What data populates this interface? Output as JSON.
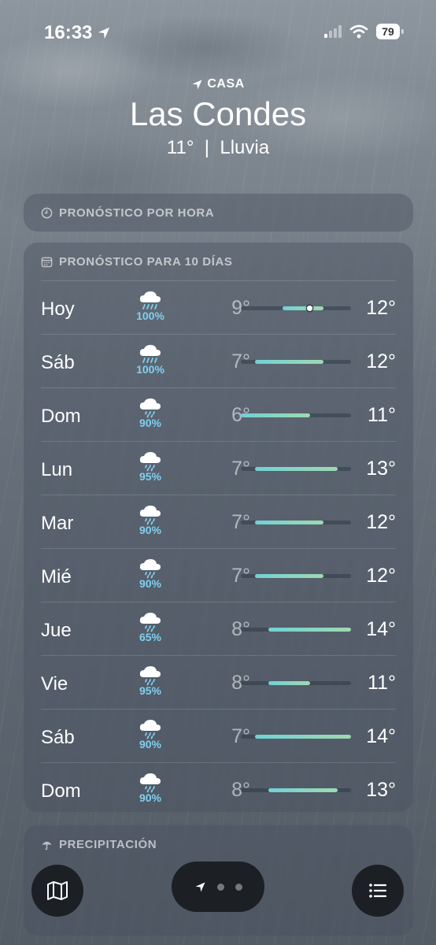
{
  "status": {
    "time": "16:33",
    "battery": "79"
  },
  "header": {
    "location_label": "CASA",
    "city": "Las Condes",
    "temp": "11°",
    "separator": "|",
    "condition": "Lluvia"
  },
  "hourly": {
    "title": "PRONÓSTICO POR HORA"
  },
  "daily": {
    "title": "PRONÓSTICO PARA 10 DÍAS",
    "scale_min": 6,
    "scale_max": 14,
    "days": [
      {
        "day": "Hoy",
        "icon": "rain-cloud-icon",
        "pct": "100%",
        "lo": "9°",
        "hi": "12°",
        "low": 9,
        "high": 12,
        "current": 11
      },
      {
        "day": "Sáb",
        "icon": "rain-cloud-icon",
        "pct": "100%",
        "lo": "7°",
        "hi": "12°",
        "low": 7,
        "high": 12
      },
      {
        "day": "Dom",
        "icon": "drizzle-cloud-icon",
        "pct": "90%",
        "lo": "6°",
        "hi": "11°",
        "low": 6,
        "high": 11
      },
      {
        "day": "Lun",
        "icon": "drizzle-cloud-icon",
        "pct": "95%",
        "lo": "7°",
        "hi": "13°",
        "low": 7,
        "high": 13
      },
      {
        "day": "Mar",
        "icon": "drizzle-cloud-icon",
        "pct": "90%",
        "lo": "7°",
        "hi": "12°",
        "low": 7,
        "high": 12
      },
      {
        "day": "Mié",
        "icon": "drizzle-cloud-icon",
        "pct": "90%",
        "lo": "7°",
        "hi": "12°",
        "low": 7,
        "high": 12
      },
      {
        "day": "Jue",
        "icon": "drizzle-cloud-icon",
        "pct": "65%",
        "lo": "8°",
        "hi": "14°",
        "low": 8,
        "high": 14
      },
      {
        "day": "Vie",
        "icon": "drizzle-cloud-icon",
        "pct": "95%",
        "lo": "8°",
        "hi": "11°",
        "low": 8,
        "high": 11
      },
      {
        "day": "Sáb",
        "icon": "drizzle-cloud-icon",
        "pct": "90%",
        "lo": "7°",
        "hi": "14°",
        "low": 7,
        "high": 14
      },
      {
        "day": "Dom",
        "icon": "drizzle-cloud-icon",
        "pct": "90%",
        "lo": "8°",
        "hi": "13°",
        "low": 8,
        "high": 13
      }
    ]
  },
  "precipitation": {
    "title": "PRECIPITACIÓN"
  },
  "colors": {
    "precip": "#7fd0f2",
    "bar_start": "#6fd2d7",
    "bar_end": "#9fd9b0"
  },
  "nav": {
    "map_icon": "map-icon",
    "location_icon": "location-arrow-icon",
    "list_icon": "list-icon"
  }
}
